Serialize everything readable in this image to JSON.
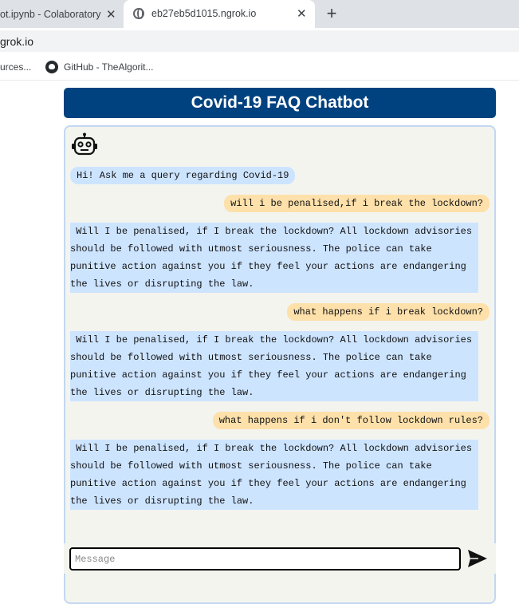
{
  "browser": {
    "tabs": [
      {
        "title": "ot.ipynb - Colaboratory",
        "close": "✕"
      },
      {
        "title": "eb27eb5d1015.ngrok.io",
        "close": "✕"
      }
    ],
    "new_tab": "+",
    "address": "grok.io",
    "bookmarks": [
      "urces...",
      "GitHub - TheAlgorit..."
    ]
  },
  "chat": {
    "title": "Covid-19 FAQ Chatbot",
    "messages": [
      {
        "from": "bot",
        "text": "Hi! Ask me a query regarding Covid-19"
      },
      {
        "from": "user",
        "text": "will i be penalised,if i break the lockdown?"
      },
      {
        "from": "bot",
        "text": " Will I be penalised, if I break the lockdown? All lockdown advisories should be followed with utmost seriousness. The police can take punitive action against you if they feel your actions are endangering the lives or disrupting the law."
      },
      {
        "from": "user",
        "text": "what happens if i break lockdown?"
      },
      {
        "from": "bot",
        "text": " Will I be penalised, if I break the lockdown? All lockdown advisories should be followed with utmost seriousness. The police can take punitive action against you if they feel your actions are endangering the lives or disrupting the law."
      },
      {
        "from": "user",
        "text": "what happens if i don't follow lockdown rules?"
      },
      {
        "from": "bot",
        "text": " Will I be penalised, if I break the lockdown? All lockdown advisories should be followed with utmost seriousness. The police can take punitive action against you if they feel your actions are endangering the lives or disrupting the law."
      }
    ],
    "input": {
      "placeholder": "Message",
      "value": ""
    },
    "colors": {
      "header": "#00427f",
      "bot_bubble": "#cde4ff",
      "user_bubble": "#fde0aa",
      "chat_bg": "#f4f4ef"
    }
  },
  "icons": {
    "robot": "robot-icon",
    "send": "send-icon",
    "github": "github-icon",
    "globe": "globe-icon"
  }
}
